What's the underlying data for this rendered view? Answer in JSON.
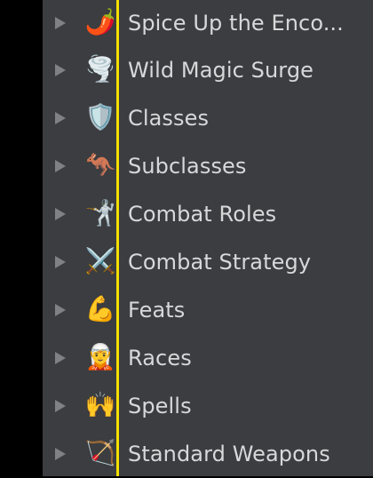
{
  "tree": {
    "items": [
      {
        "label": "Spice Up the Enco...",
        "icon": "🌶️",
        "icon_name": "hot-pepper-icon"
      },
      {
        "label": "Wild Magic Surge",
        "icon": "🌪️",
        "icon_name": "tornado-icon"
      },
      {
        "label": "Classes",
        "icon": "🛡️",
        "icon_name": "shield-icon"
      },
      {
        "label": "Subclasses",
        "icon": "🦘",
        "icon_name": "round-shield-icon"
      },
      {
        "label": "Combat Roles",
        "icon": "🤺",
        "icon_name": "fencer-icon"
      },
      {
        "label": "Combat Strategy",
        "icon": "⚔️",
        "icon_name": "crossed-swords-icon"
      },
      {
        "label": "Feats",
        "icon": "💪",
        "icon_name": "flexed-biceps-icon"
      },
      {
        "label": "Races",
        "icon": "🧝",
        "icon_name": "elf-icon"
      },
      {
        "label": "Spells",
        "icon": "🙌",
        "icon_name": "raising-hands-icon"
      },
      {
        "label": "Standard Weapons",
        "icon": "🏹",
        "icon_name": "bow-and-arrow-icon"
      }
    ]
  },
  "colors": {
    "panel_background": "#3b3d40",
    "label_text": "#d7d8da",
    "disclosure_triangle": "#7f8185",
    "guide_line": "#f5e000"
  }
}
